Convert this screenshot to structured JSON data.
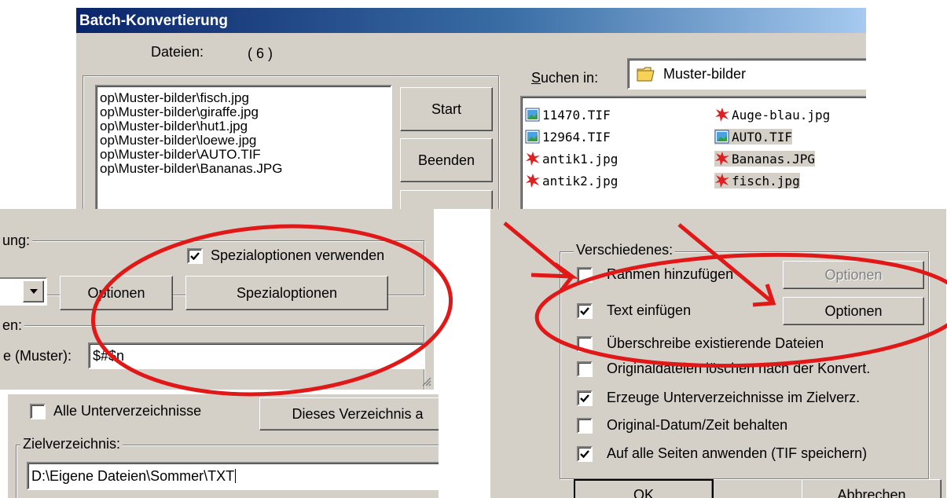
{
  "colors": {
    "face": "#d4d0c8",
    "title_bar": "#0a246a",
    "title_text": "#ffffff",
    "annotation": "#e01818",
    "list_selected_bg": "#d4d0c8"
  },
  "panel1": {
    "title": "Batch-Konvertierung",
    "files_label": "Dateien:",
    "files_count": "( 6 )",
    "files": [
      "op\\Muster-bilder\\fisch.jpg",
      "op\\Muster-bilder\\giraffe.jpg",
      "op\\Muster-bilder\\hut1.jpg",
      "op\\Muster-bilder\\loewe.jpg",
      "op\\Muster-bilder\\AUTO.TIF",
      "op\\Muster-bilder\\Bananas.JPG"
    ],
    "start_label": "Start",
    "end_label": "Beenden",
    "search_in_label": "Suchen in:",
    "folder_value": "Muster-bilder",
    "folder_icon": "folder-icon",
    "browser_files": [
      {
        "name": "11470.TIF",
        "icon": "tif-image-icon"
      },
      {
        "name": "Auge-blau.jpg",
        "icon": "jpg-image-icon"
      },
      {
        "name": "12964.TIF",
        "icon": "tif-image-icon"
      },
      {
        "name": "AUTO.TIF",
        "icon": "tif-image-icon"
      },
      {
        "name": "antik1.jpg",
        "icon": "jpg-image-icon"
      },
      {
        "name": "Bananas.JPG",
        "icon": "jpg-image-icon"
      },
      {
        "name": "antik2.jpg",
        "icon": "jpg-image-icon"
      },
      {
        "name": "fisch.jpg",
        "icon": "jpg-image-icon"
      }
    ]
  },
  "panel2": {
    "group1_label": "ung:",
    "special_checkbox_label": "Spezialoptionen verwenden",
    "special_checkbox_checked": true,
    "options_label": "Optionen",
    "special_options_label": "Spezialoptionen",
    "group2_label": "en:",
    "pattern_label": "e (Muster):",
    "pattern_value": "$#$n"
  },
  "panel3": {
    "subdirs_label": "Alle Unterverzeichnisse",
    "subdirs_checked": false,
    "this_dir_label": "Dieses Verzeichnis a",
    "target_label": "Zielverzeichnis:",
    "target_value": "D:\\Eigene Dateien\\Sommer\\TXT"
  },
  "panel4": {
    "group_label": "Verschiedenes:",
    "frame_label": "Rahmen hinzufügen",
    "frame_checked": false,
    "frame_options_label": "Optionen",
    "text_label": "Text einfügen",
    "text_checked": true,
    "text_options_label": "Optionen",
    "overwrite_label": "Überschreibe existierende Dateien",
    "overwrite_checked": false,
    "delete_label": "Originaldateien löschen nach der Konvert.",
    "delete_checked": false,
    "subdir_create_label": "Erzeuge Unterverzeichnisse im Zielverz.",
    "subdir_create_checked": true,
    "keep_date_label": "Original-Datum/Zeit behalten",
    "keep_date_checked": false,
    "all_pages_label": "Auf alle Seiten anwenden (TIF speichern)",
    "all_pages_checked": true,
    "ok_label": "OK",
    "cancel_label": "Abbrechen"
  }
}
